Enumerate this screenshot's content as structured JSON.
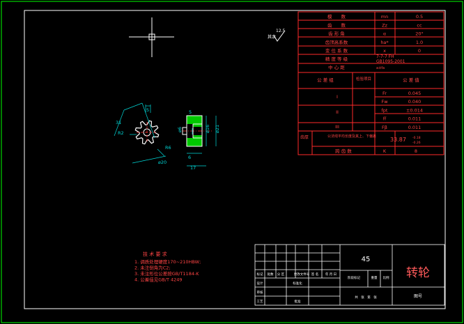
{
  "colors": {
    "background": "#000000",
    "frame": "#ffffff",
    "outer_frame": "#00ff00",
    "table_red": "#ff2a2a",
    "table_red_text": "#ff4444",
    "part_outline": "#ffffff",
    "section_hatch": "#00c800",
    "dimension": "#00d8d8",
    "centerline": "#ff3030",
    "crosshair": "#ffffff",
    "title_text": "#ffffff",
    "title_part": "#ff5a5a",
    "surface_mark": "#ffffff"
  },
  "icons": {
    "crosshair": "cad-crosshair-cursor-icon",
    "roughness": "surface-roughness-symbol-icon"
  },
  "roughness": {
    "label": "其余",
    "value": "12.5"
  },
  "param_table": {
    "rows": [
      {
        "name": "模　　数",
        "symbol": "mn",
        "value": "0.5"
      },
      {
        "name": "齿　　数",
        "symbol": "Zz",
        "value": "cc"
      },
      {
        "name": "齿 形 角",
        "symbol": "α",
        "value": "20°"
      },
      {
        "name": "齿顶高系数",
        "symbol": "ha*",
        "value": "1.0"
      },
      {
        "name": "变 位 系 数",
        "symbol": "x",
        "value": "0"
      }
    ],
    "grade_label": "精 度 等 级",
    "grade_value": "7-7-7 FH",
    "grade_value2": "GB1095-2001",
    "center_label": "中 心 距",
    "center_value": "a±fa",
    "tolerance_header": {
      "group": "公 差 组",
      "item": "检验项目",
      "value": "公 差 值"
    },
    "groups": [
      "I",
      "II",
      "III"
    ],
    "tolerances": [
      {
        "symbol": "Fr",
        "value": "0.045"
      },
      {
        "symbol": "Fw",
        "value": "0.040"
      },
      {
        "symbol": "fpt",
        "value": "±0.014"
      },
      {
        "symbol": "ff",
        "value": "0.011"
      },
      {
        "symbol": "Fβ",
        "value": "0.011"
      }
    ],
    "span_group": "齿厚",
    "span_label": "公法线平均长度及其上、下偏差",
    "span_value": "33.87",
    "span_dev_upper": "-0.18",
    "span_dev_lower": "-0.26",
    "span_count_label": "跨 齿 数",
    "span_count_symbol": "K",
    "span_count_value": "8"
  },
  "dimensions": {
    "front": [
      "R2",
      "R6",
      "5",
      "31",
      "⌀20"
    ],
    "section": [
      "5",
      "⌀6",
      "⌀16",
      "⌀21",
      "6",
      "17"
    ]
  },
  "tech_requirements": {
    "title": "技 术 要 求",
    "items": [
      "1. 调质处理硬度170~210HBW;",
      "2. 未注倒角为C2;",
      "3. 未注形位公差按GB/T1184-K",
      "4. 公差值见GB/T 4249"
    ]
  },
  "title_block": {
    "material": "45",
    "part_name": "转轮",
    "drawing_no_label": "图号",
    "header_cells": [
      "标记",
      "处数",
      "分 区",
      "更改文件号",
      "签 名",
      "年 月 日"
    ],
    "row_labels": [
      "设计",
      "审核",
      "工艺"
    ],
    "std_label": "标准化",
    "stage_label": "阶段标记",
    "weight_label": "重量",
    "scale_label": "比例",
    "approve_label": "批准",
    "sheet_label": "共　张　第　张"
  }
}
